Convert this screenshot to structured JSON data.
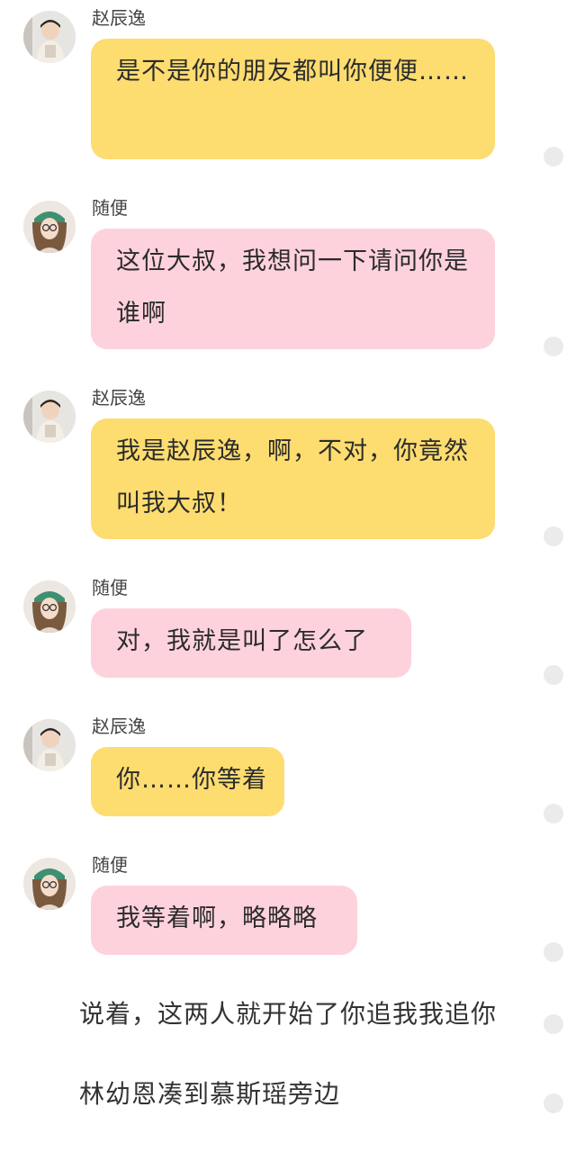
{
  "chat": {
    "messages": [
      {
        "sender": "赵辰逸",
        "text": "是不是你的朋友都叫你便便……",
        "avatar": "boy-avatar",
        "bubble_color": "#fddc70"
      },
      {
        "sender": "随便",
        "text": "这位大叔，我想问一下请问你是谁啊",
        "avatar": "girl-avatar",
        "bubble_color": "#fdd2dd"
      },
      {
        "sender": "赵辰逸",
        "text": "我是赵辰逸，啊，不对，你竟然叫我大叔！",
        "avatar": "boy-avatar",
        "bubble_color": "#fddc70"
      },
      {
        "sender": "随便",
        "text": "对，我就是叫了怎么了",
        "avatar": "girl-avatar",
        "bubble_color": "#fdd2dd"
      },
      {
        "sender": "赵辰逸",
        "text": "你……你等着",
        "avatar": "boy-avatar",
        "bubble_color": "#fddc70"
      },
      {
        "sender": "随便",
        "text": "我等着啊，略略略",
        "avatar": "girl-avatar",
        "bubble_color": "#fdd2dd"
      }
    ],
    "narrations": [
      {
        "text": "说着，这两人就开始了你追我我追你"
      },
      {
        "text": "林幼恩凑到慕斯瑶旁边"
      }
    ],
    "comment_icon": "comment-dot-icon"
  }
}
